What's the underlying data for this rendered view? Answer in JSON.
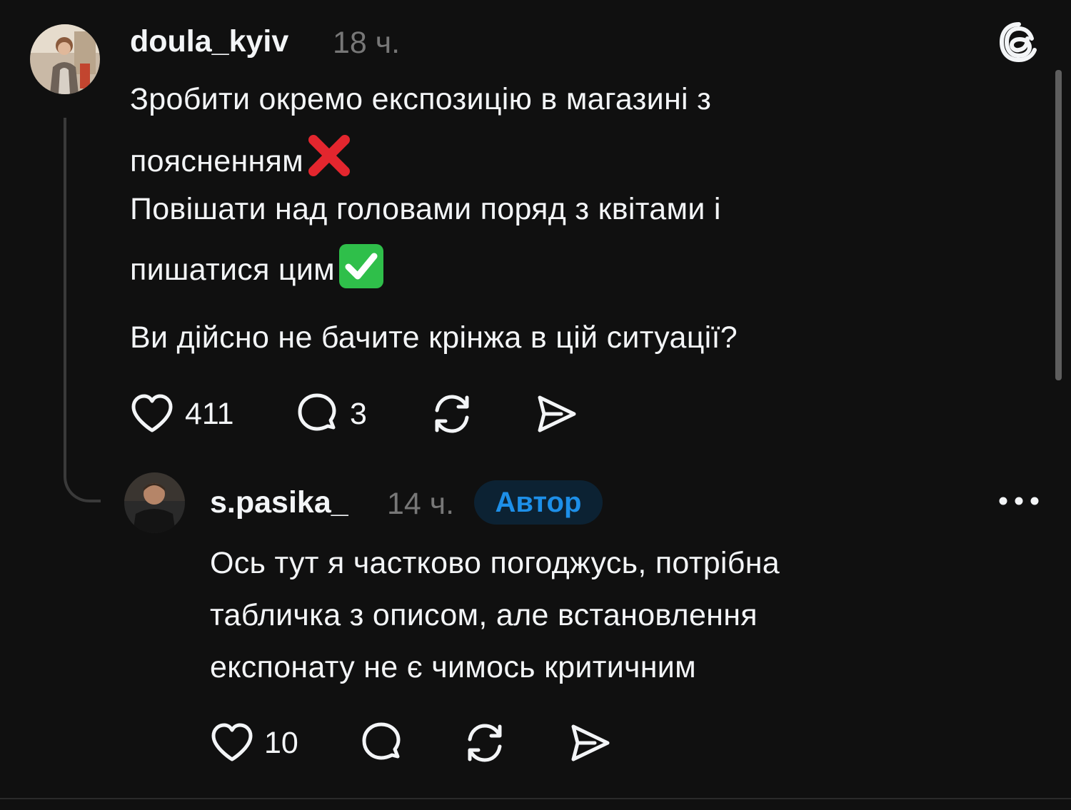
{
  "post": {
    "username": "doula_kyiv",
    "time": "18 ч.",
    "lines": [
      "Зробити окремо експозицію в магазині з",
      "поясненням",
      "Повішати над головами поряд з квітами і",
      "пишатися цим",
      "Ви дійсно не бачите крінжа в цій ситуації?"
    ],
    "emoji_cross": "❌",
    "emoji_check": "✅",
    "likes": "411",
    "replies": "3",
    "icons": {
      "app_logo": "threads-logo-icon",
      "like": "heart-icon",
      "reply": "comment-bubble-icon",
      "repost": "repost-icon",
      "share": "send-icon"
    }
  },
  "reply": {
    "username": "s.pasika_",
    "time": "14 ч.",
    "badge": "Автор",
    "lines": [
      "Ось тут я частково погоджусь, потрібна",
      "табличка з описом, але встановлення",
      "експонату не є чимось критичним"
    ],
    "likes": "10",
    "icons": {
      "more": "more-dots-icon",
      "like": "heart-icon",
      "reply": "comment-bubble-icon",
      "repost": "repost-icon",
      "share": "send-icon"
    }
  },
  "colors": {
    "background": "#101010",
    "text": "#f3f5f7",
    "muted": "#777777",
    "badge_text": "#1d8fe8",
    "badge_bg": "#0c2233",
    "thread_line": "#3a3a3a"
  }
}
